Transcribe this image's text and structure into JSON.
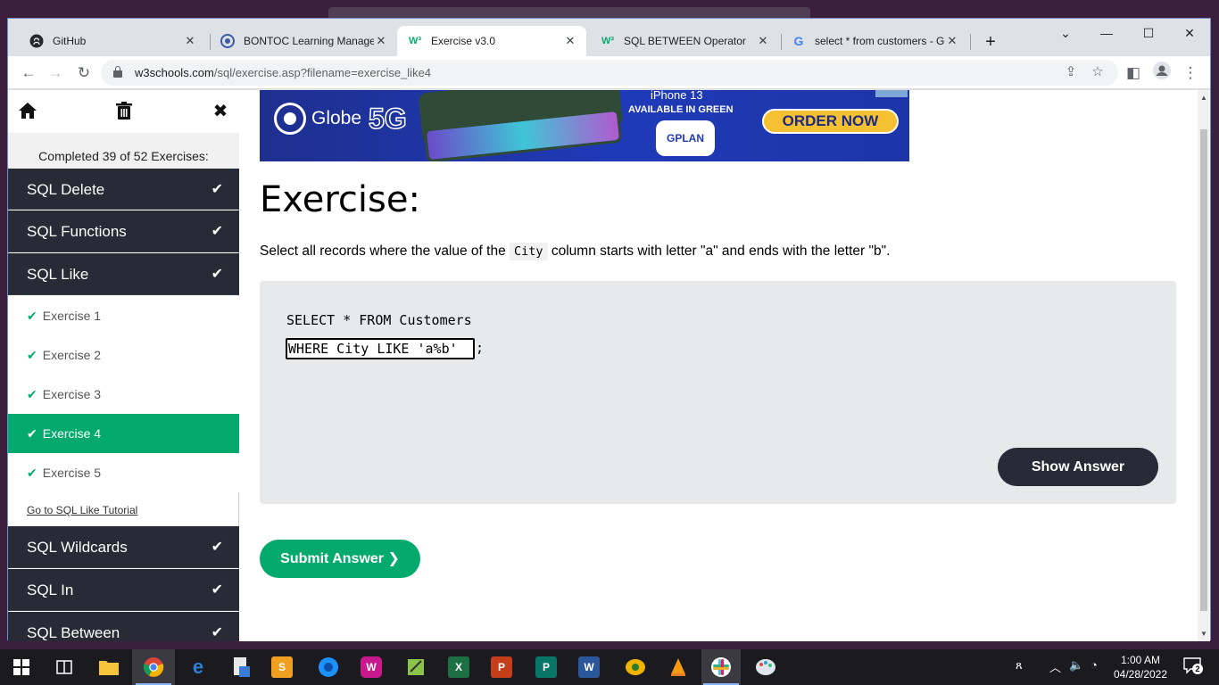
{
  "browser": {
    "tabs": [
      {
        "title": "GitHub",
        "favicon": "github-icon",
        "active": false
      },
      {
        "title": "BONTOC Learning Managem",
        "favicon": "moodle-icon",
        "active": false
      },
      {
        "title": "Exercise v3.0",
        "favicon": "w3schools-icon",
        "active": true
      },
      {
        "title": "SQL BETWEEN Operator",
        "favicon": "w3schools-icon",
        "active": false
      },
      {
        "title": "select * from customers - Go",
        "favicon": "google-icon",
        "active": false
      }
    ],
    "new_tab_label": "+",
    "url_host": "w3schools.com",
    "url_path": "/sql/exercise.asp?filename=exercise_like4"
  },
  "sidebar": {
    "completed_text": "Completed 39 of 52 Exercises:",
    "categories_above": [
      {
        "label": "SQL Delete"
      },
      {
        "label": "SQL Functions"
      },
      {
        "label": "SQL Like"
      }
    ],
    "exercises": [
      {
        "label": "Exercise 1"
      },
      {
        "label": "Exercise 2"
      },
      {
        "label": "Exercise 3"
      },
      {
        "label": "Exercise 4",
        "active": true
      },
      {
        "label": "Exercise 5"
      }
    ],
    "tutorial_link": "Go to SQL Like Tutorial",
    "categories_below": [
      {
        "label": "SQL Wildcards"
      },
      {
        "label": "SQL In"
      },
      {
        "label": "SQL Between"
      }
    ]
  },
  "ad": {
    "brand": "Globe",
    "network": "5G",
    "product": "iPhone 13",
    "tagline": "AVAILABLE IN GREEN",
    "plan": "PLAN",
    "cta": "ORDER NOW"
  },
  "main": {
    "heading": "Exercise:",
    "instruction_before": "Select all records where the value of the",
    "instruction_code": "City",
    "instruction_after": "column starts with letter \"a\" and ends with the letter \"b\".",
    "code_line1": "SELECT * FROM Customers",
    "answer_value": "WHERE City LIKE 'a%b'",
    "code_suffix": ";",
    "show_answer_label": "Show Answer",
    "submit_label": "Submit Answer ❯"
  },
  "taskbar": {
    "time": "1:00 AM",
    "date": "04/28/2022",
    "notifications": "2"
  },
  "colors": {
    "w3_green": "#04aa6d",
    "sidebar_dark": "#282a35",
    "code_bg": "#e7e9eb"
  }
}
